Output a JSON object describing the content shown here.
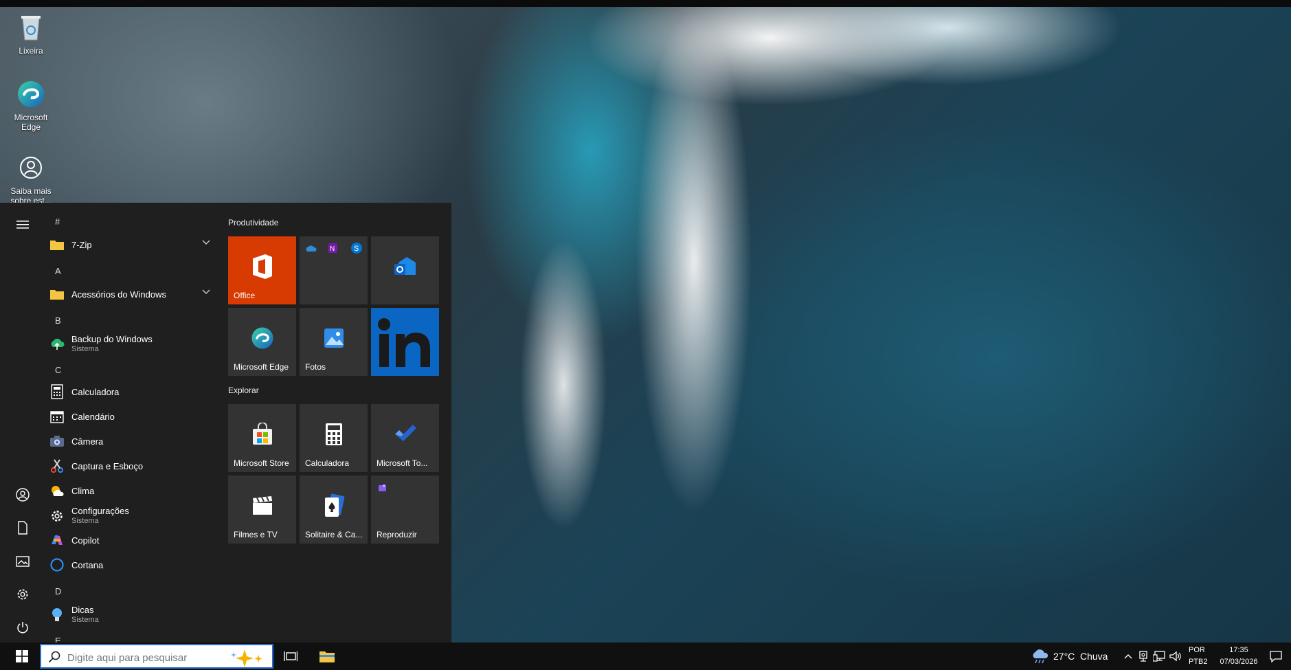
{
  "desktop": {
    "icons": [
      {
        "label": "Lixeira"
      },
      {
        "label": "Microsoft Edge"
      },
      {
        "label": "Saiba mais sobre est..."
      }
    ]
  },
  "start_menu": {
    "app_list": {
      "sections": [
        {
          "letter": "#",
          "apps": [
            {
              "name": "7-Zip",
              "folder": true
            }
          ]
        },
        {
          "letter": "A",
          "apps": [
            {
              "name": "Acessórios do Windows",
              "folder": true
            }
          ]
        },
        {
          "letter": "B",
          "apps": [
            {
              "name": "Backup do Windows",
              "sub": "Sistema"
            }
          ]
        },
        {
          "letter": "C",
          "apps": [
            {
              "name": "Calculadora"
            },
            {
              "name": "Calendário"
            },
            {
              "name": "Câmera"
            },
            {
              "name": "Captura e Esboço"
            },
            {
              "name": "Clima"
            },
            {
              "name": "Configurações",
              "sub": "Sistema"
            },
            {
              "name": "Copilot"
            },
            {
              "name": "Cortana"
            }
          ]
        },
        {
          "letter": "D",
          "apps": [
            {
              "name": "Dicas",
              "sub": "Sistema"
            }
          ]
        },
        {
          "letter": "E",
          "apps": []
        }
      ]
    },
    "tile_groups": [
      {
        "title": "Produtividade",
        "tiles": [
          {
            "label": "Office",
            "icon": "office-icon",
            "color": "#d83b01"
          },
          {
            "label": "",
            "icon": "onedrive-onenote-skype-icons"
          },
          {
            "label": "",
            "icon": "outlook-icon"
          },
          {
            "label": "Microsoft Edge",
            "icon": "edge-icon"
          },
          {
            "label": "Fotos",
            "icon": "photos-icon"
          },
          {
            "label": "",
            "icon": "linkedin-icon",
            "color": "#0a66c2"
          }
        ]
      },
      {
        "title": "Explorar",
        "tiles": [
          {
            "label": "Microsoft Store",
            "icon": "store-icon"
          },
          {
            "label": "Calculadora",
            "icon": "calculator-icon"
          },
          {
            "label": "Microsoft To...",
            "icon": "todo-icon"
          },
          {
            "label": "Filmes e TV",
            "icon": "movies-icon"
          },
          {
            "label": "Solitaire & Ca...",
            "icon": "solitaire-icon"
          },
          {
            "label": "Reproduzir",
            "icon": "play-icon"
          }
        ]
      }
    ]
  },
  "taskbar": {
    "search_placeholder": "Digite aqui para pesquisar",
    "weather": {
      "temp": "27°C",
      "condition": "Chuva"
    },
    "language": {
      "line1": "POR",
      "line2": "PTB2"
    },
    "clock": {
      "time": "17:35",
      "date": "07/03/2026"
    }
  },
  "colors": {
    "accent": "#2b6cd8",
    "start_bg": "#1f1f1f",
    "tile_bg": "#333333",
    "taskbar_bg": "#101010"
  }
}
